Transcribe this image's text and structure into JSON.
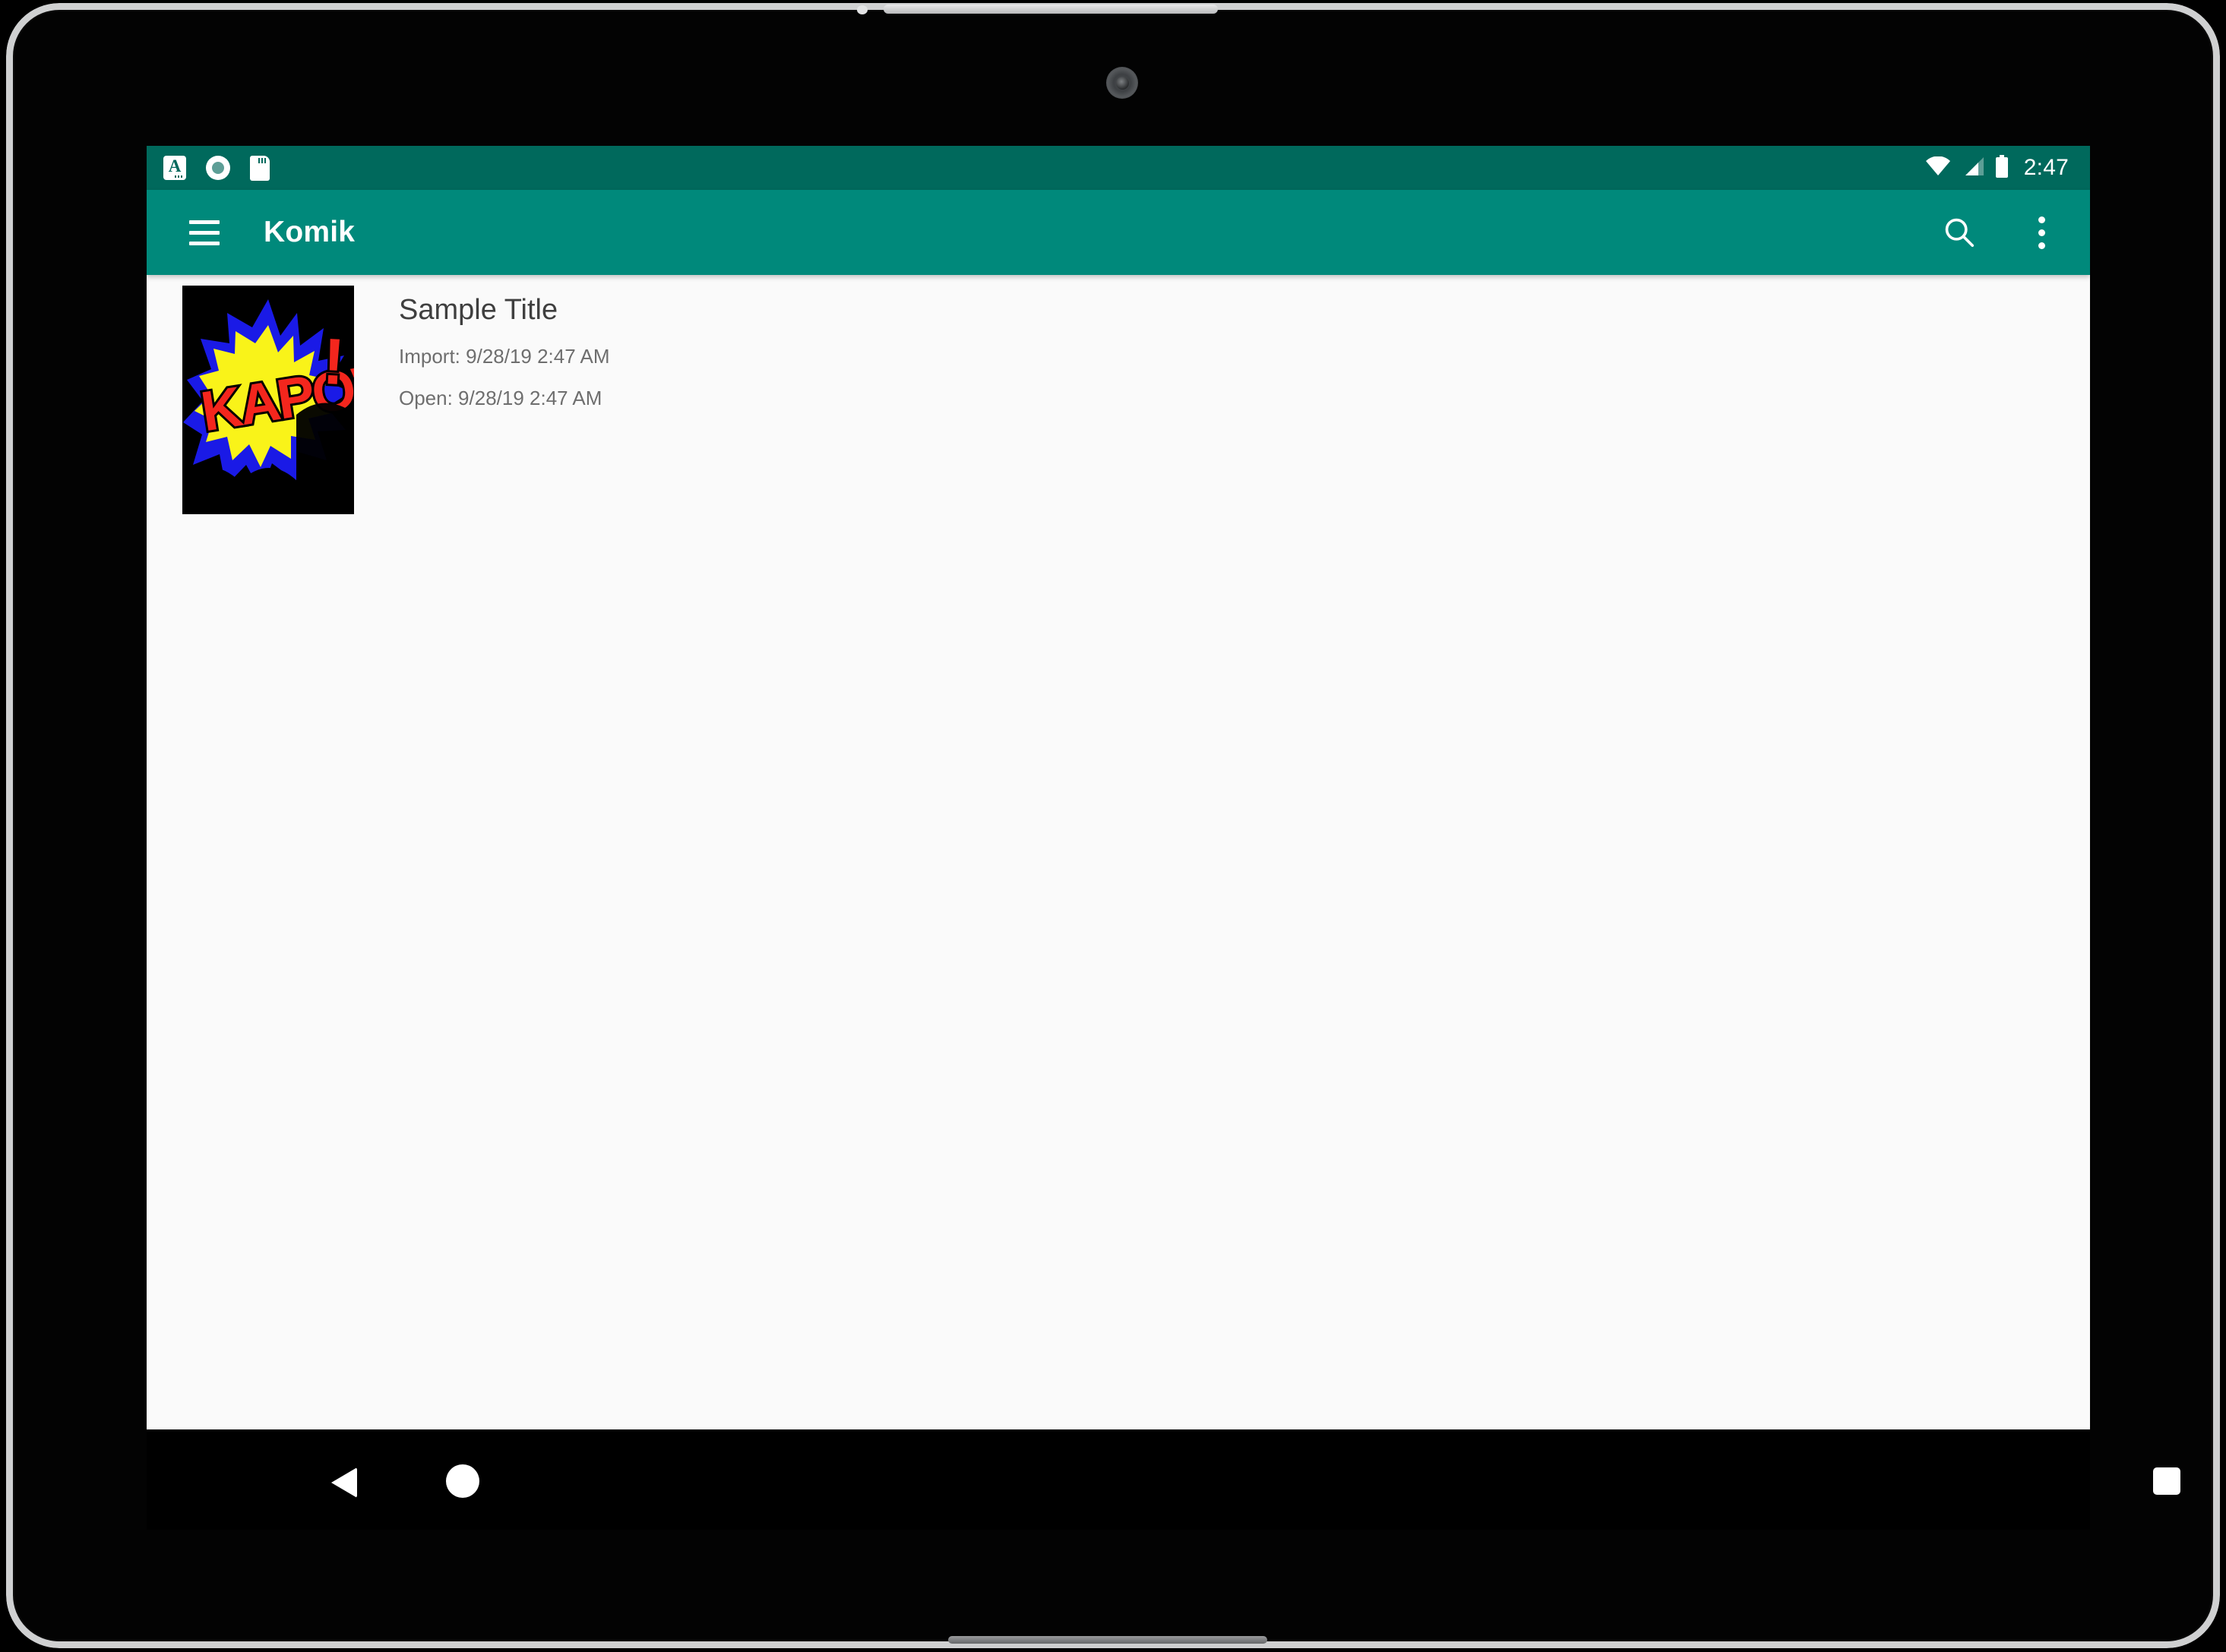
{
  "device": {
    "type": "android-tablet",
    "frame_color": "#0a0a0a",
    "bezel_color": "#cfd0d1"
  },
  "status_bar": {
    "background": "#00695c",
    "time": "2:47",
    "left_icons": [
      {
        "name": "keyboard-language-icon",
        "label": "A"
      },
      {
        "name": "record-circle-icon",
        "label": ""
      },
      {
        "name": "sd-card-icon",
        "label": ""
      }
    ],
    "right_icons": [
      {
        "name": "wifi-icon",
        "label": ""
      },
      {
        "name": "cellular-signal-icon",
        "label": ""
      },
      {
        "name": "battery-icon",
        "label": ""
      }
    ]
  },
  "app_bar": {
    "background": "#00897b",
    "title": "Komik",
    "menu_label": "Navigation drawer",
    "search_label": "Search",
    "overflow_label": "More options"
  },
  "content": {
    "background": "#fafafa",
    "comics": [
      {
        "title": "Sample Title",
        "import_label": "Import: 9/28/19 2:47 AM",
        "open_label": "Open: 9/28/19 2:47 AM",
        "cover_alt": "KAPOW!",
        "cover_colors": {
          "background": "#000000",
          "burst_outer": "#1a1ae6",
          "burst_inner": "#f9f319",
          "text": "#f4261d",
          "text_outline": "#000000"
        }
      }
    ]
  },
  "nav_bar": {
    "background": "#000000",
    "buttons": [
      {
        "name": "back-button",
        "label": "Back"
      },
      {
        "name": "home-button",
        "label": "Home"
      },
      {
        "name": "recents-button",
        "label": "Recent apps"
      }
    ]
  }
}
